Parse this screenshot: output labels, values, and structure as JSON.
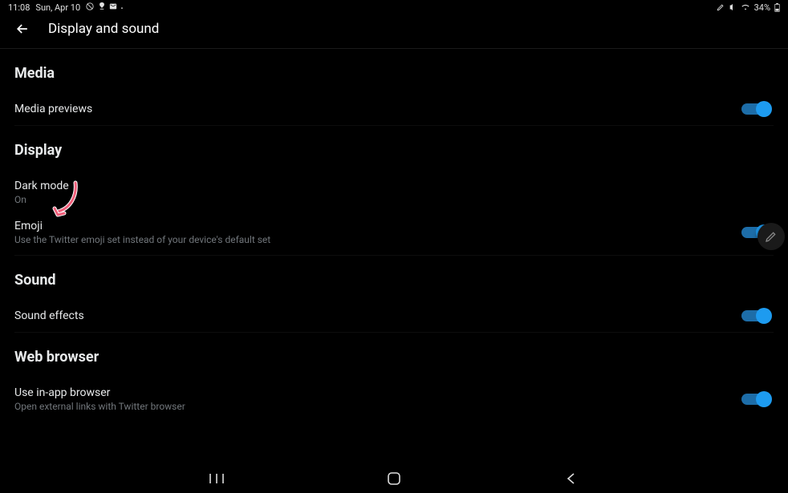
{
  "status": {
    "time": "11:08",
    "date": "Sun, Apr 10",
    "battery": "34%"
  },
  "header": {
    "title": "Display and sound"
  },
  "sections": {
    "media": {
      "header": "Media",
      "previews_label": "Media previews"
    },
    "display": {
      "header": "Display",
      "dark_mode_label": "Dark mode",
      "dark_mode_value": "On",
      "emoji_label": "Emoji",
      "emoji_sub": "Use the Twitter emoji set instead of your device's default set"
    },
    "sound": {
      "header": "Sound",
      "effects_label": "Sound effects"
    },
    "web": {
      "header": "Web browser",
      "inapp_label": "Use in-app browser",
      "inapp_sub": "Open external links with Twitter browser"
    }
  },
  "toggles": {
    "media_previews": true,
    "emoji": true,
    "sound_effects": true,
    "in_app_browser": true
  }
}
